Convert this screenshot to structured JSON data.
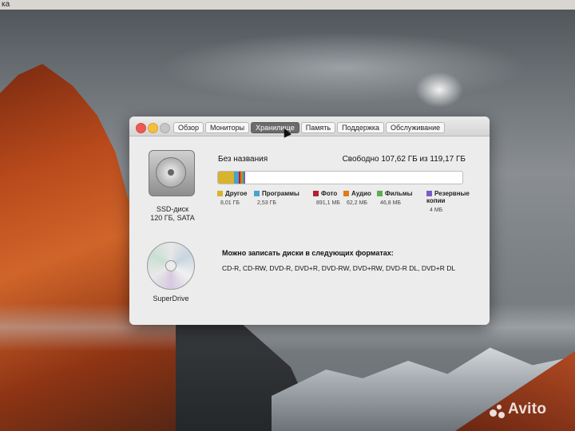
{
  "menubar": {
    "text": "ка"
  },
  "window": {
    "tabs": [
      {
        "label": "Обзор",
        "active": false
      },
      {
        "label": "Мониторы",
        "active": false
      },
      {
        "label": "Хранилище",
        "active": true
      },
      {
        "label": "Память",
        "active": false
      },
      {
        "label": "Поддержка",
        "active": false
      },
      {
        "label": "Обслуживание",
        "active": false
      }
    ],
    "disks": [
      {
        "icon": "hard-drive-icon",
        "name": "SSD-диск",
        "detail": "120 ГБ, SATA"
      },
      {
        "icon": "optical-disc-icon",
        "name": "SuperDrive"
      }
    ],
    "volume": {
      "name": "Без названия",
      "free_text": "Свободно 107,62 ГБ из 119,17 ГБ",
      "usage_fraction": 0.097
    },
    "legend": [
      {
        "name": "Другое",
        "size": "8,01 ГБ",
        "color": "#d8b32e"
      },
      {
        "name": "Программы",
        "size": "2,53 ГБ",
        "color": "#4aa3c8"
      },
      {
        "name": "Фото",
        "size": "891,1 МБ",
        "color": "#b42032"
      },
      {
        "name": "Аудио",
        "size": "62,2 МБ",
        "color": "#e07a1a"
      },
      {
        "name": "Фильмы",
        "size": "46,8 МБ",
        "color": "#5bb04a"
      },
      {
        "name": "Резервные копии",
        "size": "4 МБ",
        "color": "#7b5bc4"
      }
    ],
    "burn": {
      "title": "Можно записать диски в следующих форматах:",
      "formats": "CD-R, CD-RW, DVD-R, DVD+R, DVD-RW, DVD+RW, DVD-R DL, DVD+R DL"
    }
  },
  "watermark": "Avito"
}
